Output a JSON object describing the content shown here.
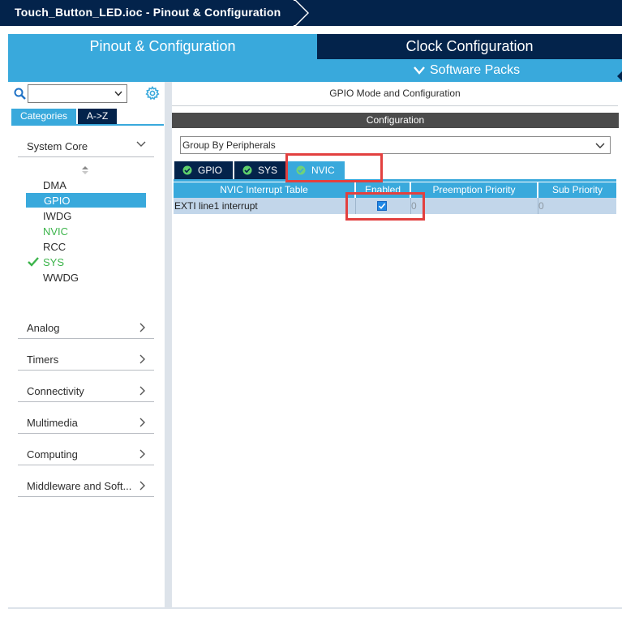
{
  "window": {
    "breadcrumb": "Touch_Button_LED.ioc - Pinout & Configuration"
  },
  "main_tabs": {
    "pinout": "Pinout & Configuration",
    "clock": "Clock Configuration",
    "software_packs": "Software Packs"
  },
  "sidebar": {
    "search_value": "",
    "view_tabs": [
      "Categories",
      "A->Z"
    ],
    "system_core": {
      "label": "System Core",
      "items": [
        "DMA",
        "GPIO",
        "IWDG",
        "NVIC",
        "RCC",
        "SYS",
        "WWDG"
      ],
      "selected": "GPIO"
    },
    "categories": [
      "Analog",
      "Timers",
      "Connectivity",
      "Multimedia",
      "Computing",
      "Middleware and Soft..."
    ]
  },
  "main": {
    "mode_title": "GPIO Mode and Configuration",
    "config_title": "Configuration",
    "group_by": "Group By Peripherals",
    "tabs": [
      "GPIO",
      "SYS",
      "NVIC"
    ],
    "active_tab": "NVIC",
    "table": {
      "headers": [
        "NVIC Interrupt Table",
        "Enabled",
        "Preemption Priority",
        "Sub Priority"
      ],
      "rows": [
        {
          "name": "EXTI line1 interrupt",
          "enabled": true,
          "preemption": "0",
          "sub": "0"
        }
      ]
    }
  },
  "colors": {
    "navy": "#03234b",
    "accent": "#39a9dc",
    "green": "#3cb44b",
    "highlight_red": "#e2403f"
  }
}
